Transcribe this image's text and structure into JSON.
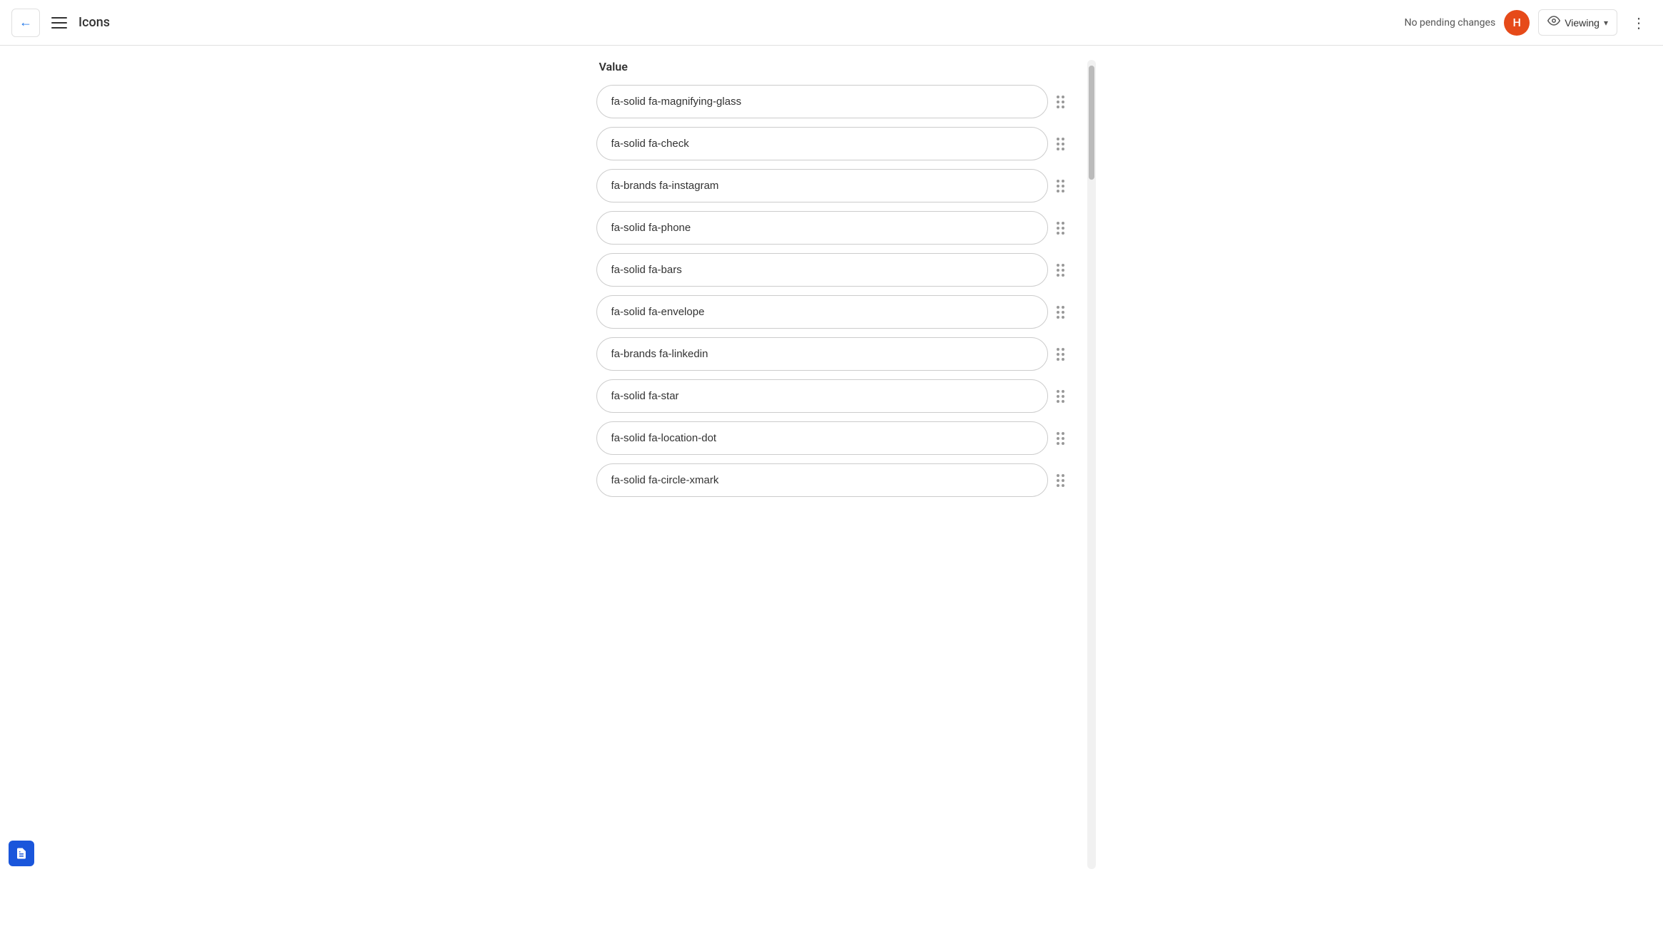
{
  "header": {
    "back_label": "←",
    "menu_icon": "hamburger",
    "title": "Icons",
    "no_pending": "No pending changes",
    "avatar_letter": "H",
    "avatar_color": "#e64a19",
    "viewing_label": "Viewing",
    "more_icon": "⋮"
  },
  "column": {
    "header": "Value"
  },
  "items": [
    {
      "id": 1,
      "value": "fa-solid fa-magnifying-glass"
    },
    {
      "id": 2,
      "value": "fa-solid fa-check"
    },
    {
      "id": 3,
      "value": "fa-brands fa-instagram"
    },
    {
      "id": 4,
      "value": "fa-solid fa-phone"
    },
    {
      "id": 5,
      "value": "fa-solid fa-bars"
    },
    {
      "id": 6,
      "value": "fa-solid fa-envelope"
    },
    {
      "id": 7,
      "value": "fa-brands fa-linkedin"
    },
    {
      "id": 8,
      "value": "fa-solid fa-star"
    },
    {
      "id": 9,
      "value": "fa-solid fa-location-dot"
    },
    {
      "id": 10,
      "value": "fa-solid fa-circle-xmark"
    }
  ],
  "bottom_icon": "document"
}
